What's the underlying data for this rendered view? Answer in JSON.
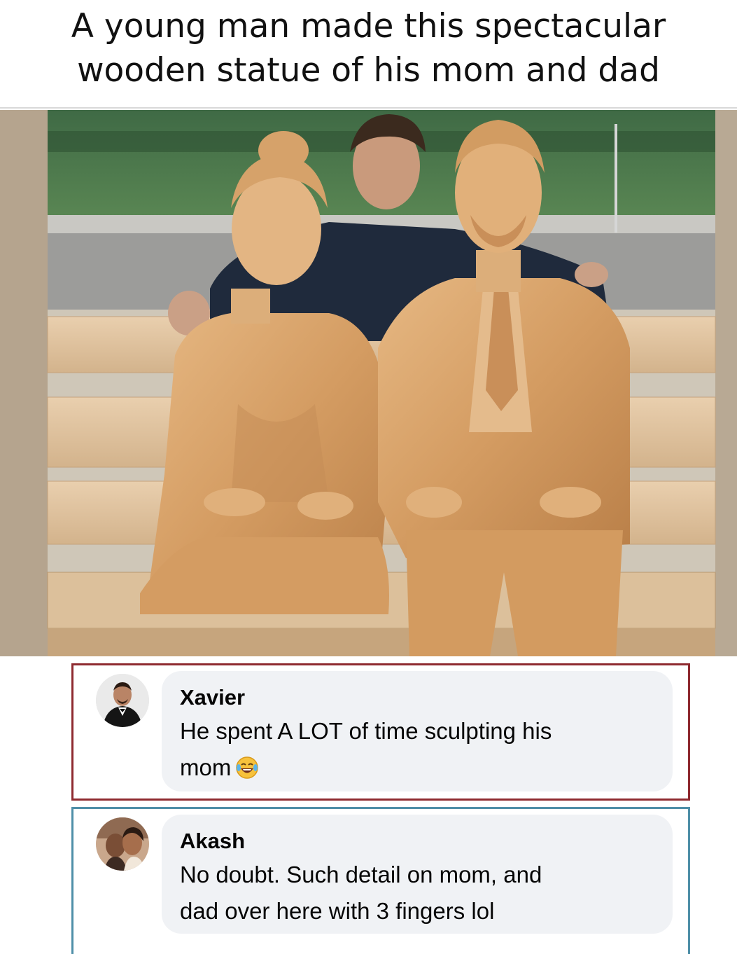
{
  "caption": {
    "line1": "A young man made this spectacular",
    "line2": "wooden statue of his mom and dad"
  },
  "photo": {
    "icon": "wooden-statue-photo"
  },
  "comments": [
    {
      "author": "Xavier",
      "line1": "He spent A LOT of time sculpting his",
      "line2": "mom",
      "emoji": "laughing-tears-emoji",
      "border_color": "#8e2a2f"
    },
    {
      "author": "Akash",
      "line1": "No doubt. Such detail on mom, and",
      "line2": "dad over here with 3 fingers lol",
      "border_color": "#4f8fa8"
    }
  ],
  "colors": {
    "bubble": "#f0f2f5",
    "text": "#050505",
    "wood": "#d9a870"
  }
}
